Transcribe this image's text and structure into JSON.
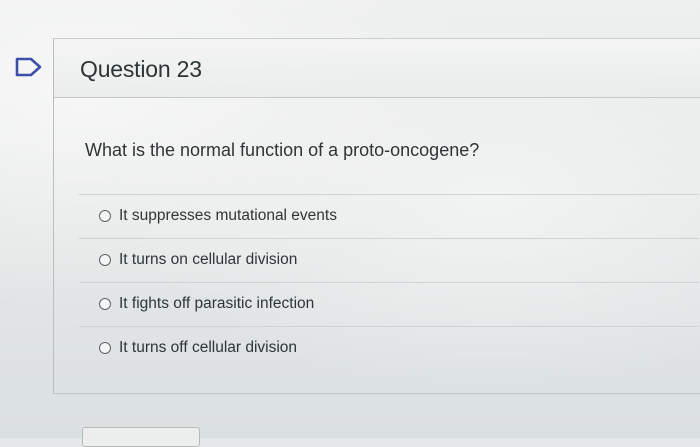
{
  "question": {
    "title": "Question 23",
    "text": "What is the normal function of a proto-oncogene?",
    "flag_icon": "flag-icon",
    "answers": [
      {
        "label": "It suppresses mutational events",
        "selected": false
      },
      {
        "label": "It turns on cellular division",
        "selected": false
      },
      {
        "label": "It fights off parasitic infection",
        "selected": false
      },
      {
        "label": "It turns off cellular division",
        "selected": false
      }
    ]
  },
  "colors": {
    "text": "#2f3537",
    "flag_stroke": "#3d4fa8"
  }
}
